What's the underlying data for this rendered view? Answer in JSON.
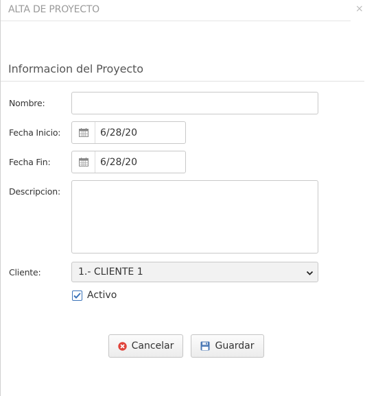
{
  "modal": {
    "title": "ALTA DE PROYECTO",
    "close_label": "×"
  },
  "section": {
    "title": "Informacion del Proyecto"
  },
  "form": {
    "nombre_label": "Nombre:",
    "nombre_value": "",
    "fecha_inicio_label": "Fecha Inicio:",
    "fecha_inicio_value": "6/28/20",
    "fecha_fin_label": "Fecha Fin:",
    "fecha_fin_value": "6/28/20",
    "descripcion_label": "Descripcion:",
    "descripcion_value": "",
    "cliente_label": "Cliente:",
    "cliente_selected": "1.- CLIENTE 1",
    "activo_label": "Activo",
    "activo_checked": true
  },
  "buttons": {
    "cancel_label": "Cancelar",
    "save_label": "Guardar"
  },
  "colors": {
    "cancel_icon": "#e0433a",
    "save_icon": "#4a78b5",
    "checkbox_accent": "#3b73b9"
  },
  "icons": {
    "calendar": "calendar-icon",
    "cancel": "cancel-circle-icon",
    "save": "floppy-disk-icon",
    "chevron": "chevron-down-icon",
    "check": "checkmark-icon"
  }
}
